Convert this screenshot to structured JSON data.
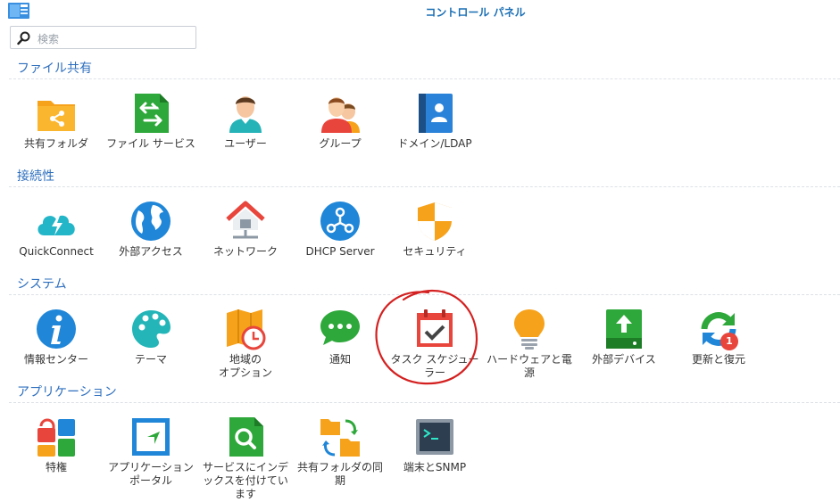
{
  "window": {
    "title": "コントロール パネル"
  },
  "search": {
    "placeholder": "検索"
  },
  "sections": [
    {
      "heading": "ファイル共有",
      "items": [
        {
          "label": "共有フォルダ"
        },
        {
          "label": "ファイル サービス"
        },
        {
          "label": "ユーザー"
        },
        {
          "label": "グループ"
        },
        {
          "label": "ドメイン/LDAP"
        }
      ]
    },
    {
      "heading": "接続性",
      "items": [
        {
          "label": "QuickConnect"
        },
        {
          "label": "外部アクセス"
        },
        {
          "label": "ネットワーク"
        },
        {
          "label": "DHCP Server"
        },
        {
          "label": "セキュリティ"
        }
      ]
    },
    {
      "heading": "システム",
      "items": [
        {
          "label": "情報センター"
        },
        {
          "label": "テーマ"
        },
        {
          "label": "地域の\nオプション"
        },
        {
          "label": "通知"
        },
        {
          "label": "タスク スケジューラー"
        },
        {
          "label": "ハードウェアと電源"
        },
        {
          "label": "外部デバイス"
        },
        {
          "label": "更新と復元",
          "badge": "1"
        }
      ]
    },
    {
      "heading": "アプリケーション",
      "items": [
        {
          "label": "特権"
        },
        {
          "label": "アプリケーション ポータル"
        },
        {
          "label": "サービスにインデックスを付けています"
        },
        {
          "label": "共有フォルダの同期"
        },
        {
          "label": "端末とSNMP"
        }
      ]
    }
  ],
  "colors": {
    "accent": "#2e6fbe",
    "annotation": "#d42020",
    "badge": "#e8453c"
  }
}
